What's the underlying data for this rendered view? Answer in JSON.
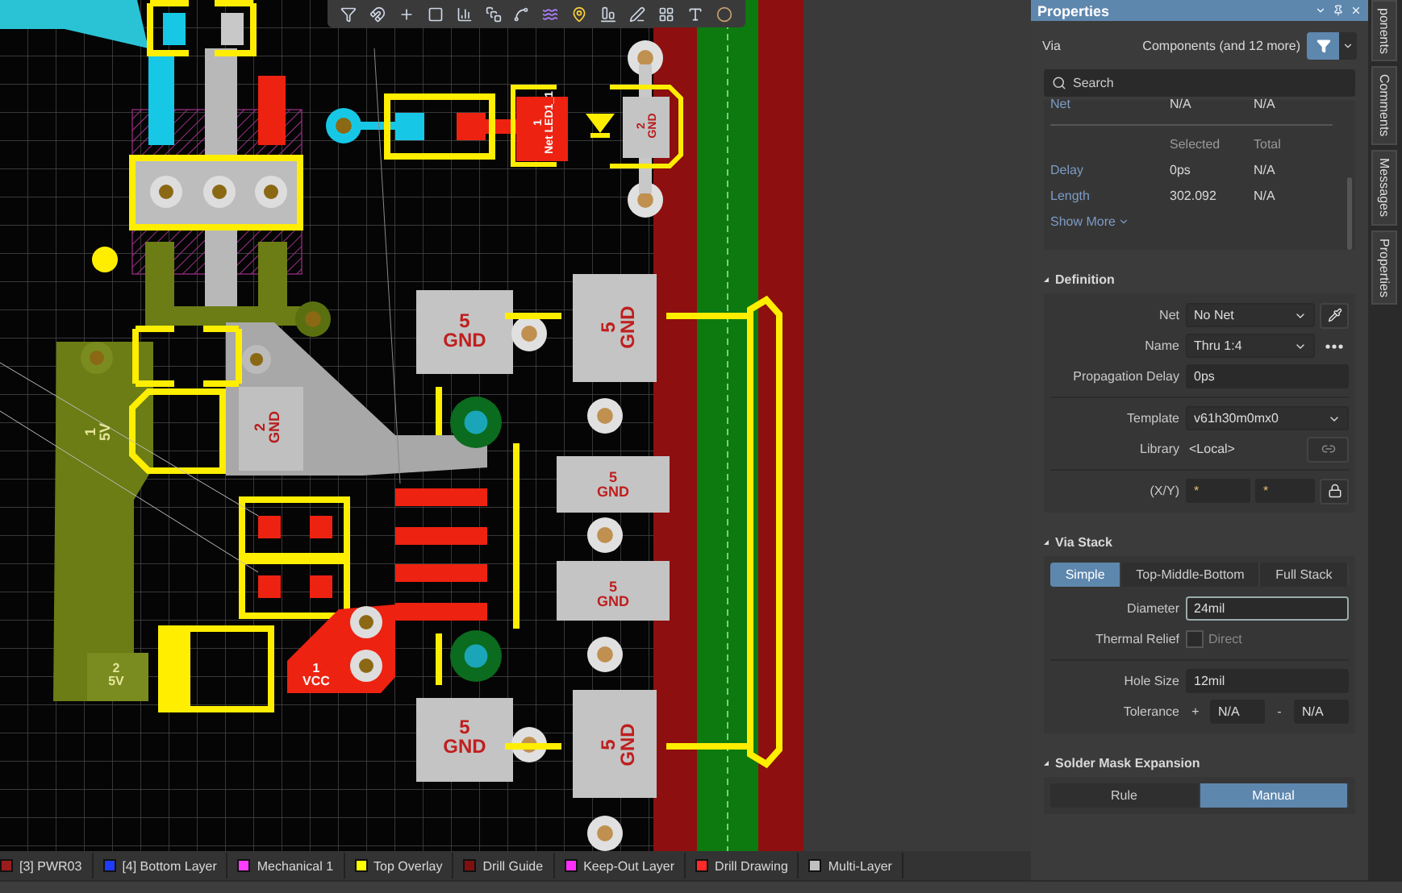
{
  "canvas": {
    "pad_labels": [
      {
        "number": "1",
        "net": "5V"
      },
      {
        "number": "2",
        "net": "5V"
      },
      {
        "number": "2",
        "net": "GND"
      },
      {
        "number": "1",
        "net": "VCC"
      },
      {
        "number": "5",
        "net": "GND"
      },
      {
        "number": "5",
        "net": "GND"
      },
      {
        "number": "5",
        "net": "GND"
      },
      {
        "number": "5",
        "net": "GND"
      },
      {
        "number": "5",
        "net": "GND"
      },
      {
        "number": "5",
        "net": "GND"
      },
      {
        "number": "1",
        "net": "Net LED1_1"
      },
      {
        "number": "2",
        "net": "GND"
      }
    ]
  },
  "layer_tabs": [
    {
      "label": "[3] PWR03",
      "color": "#9b1c1c"
    },
    {
      "label": "[4] Bottom Layer",
      "color": "#1e3cff"
    },
    {
      "label": "Mechanical 1",
      "color": "#ff3cff"
    },
    {
      "label": "Top Overlay",
      "color": "#ffff00"
    },
    {
      "label": "Drill Guide",
      "color": "#801010"
    },
    {
      "label": "Keep-Out Layer",
      "color": "#ff30ff"
    },
    {
      "label": "Drill Drawing",
      "color": "#ff2a2a"
    },
    {
      "label": "Multi-Layer",
      "color": "#c0c0c0"
    }
  ],
  "properties": {
    "title": "Properties",
    "object": "Via",
    "filter_label": "Components (and 12 more)",
    "search": {
      "placeholder": "Search"
    },
    "info_rows": [
      {
        "label": "Net",
        "selected": "N/A",
        "total": "N/A"
      }
    ],
    "timing_headers": [
      "Selected",
      "Total"
    ],
    "timing_rows": [
      {
        "label": "Delay",
        "selected": "0ps",
        "total": "N/A"
      },
      {
        "label": "Length",
        "selected": "302.092",
        "total": "N/A"
      }
    ],
    "show_more": "Show More",
    "definition": {
      "title": "Definition",
      "net": {
        "label": "Net",
        "value": "No Net"
      },
      "name": {
        "label": "Name",
        "value": "Thru 1:4"
      },
      "propagation_delay": {
        "label": "Propagation Delay",
        "value": "0ps"
      },
      "template": {
        "label": "Template",
        "value": "v61h30m0mx0"
      },
      "library": {
        "label": "Library",
        "value": "<Local>"
      },
      "xy": {
        "label": "(X/Y)",
        "x": "*",
        "y": "*"
      }
    },
    "via_stack": {
      "title": "Via Stack",
      "modes": [
        {
          "label": "Simple",
          "selected": true
        },
        {
          "label": "Top-Middle-Bottom",
          "selected": false
        },
        {
          "label": "Full Stack",
          "selected": false
        }
      ],
      "diameter": {
        "label": "Diameter",
        "value": "24mil"
      },
      "thermal_relief": {
        "label": "Thermal Relief",
        "option": "Direct",
        "checked": false
      },
      "hole_size": {
        "label": "Hole Size",
        "value": "12mil"
      },
      "tolerance": {
        "label": "Tolerance",
        "plus_sign": "+",
        "plus": "N/A",
        "minus_sign": "-",
        "minus": "N/A"
      }
    },
    "solder_mask_expansion": {
      "title": "Solder Mask Expansion",
      "modes": [
        {
          "label": "Rule",
          "selected": false
        },
        {
          "label": "Manual",
          "selected": true
        }
      ]
    }
  },
  "side_tabs": [
    "ponents",
    "Comments",
    "Messages",
    "Properties"
  ]
}
